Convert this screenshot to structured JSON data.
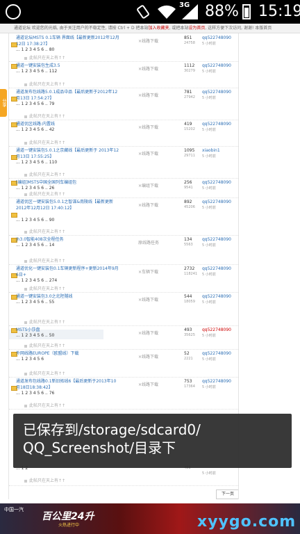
{
  "status_bar": {
    "network": "3G",
    "battery_percent": "88%",
    "time": "15:19"
  },
  "notice": {
    "text_a": "通道论坛 欢迎您的光临, 由于关注用户的不稳定性, 请按 Ctrl + D 把本站",
    "text_red": "加入收藏夹",
    "text_b": ", 或把本站",
    "text_red2": "设为首页",
    "text_c": ", 这样方便下次访问, 谢谢! 本版首页"
  },
  "left_tab": "分享",
  "threads": [
    {
      "title": "通道论坛MSTS 0.1车辆 界面线【最新更新2012年12月12日 17:38:27】",
      "pages": "... 1 2 3 4 5 6 .. 80",
      "category": "×线路下载",
      "replies": "851",
      "views": "24758",
      "last_user": "qq522748090",
      "last_time": "5 小时前",
      "note": "此帖只在天上有↑↑"
    },
    {
      "title": "通道一键安装包生成3.5",
      "pages": "... 1 2 3 4 5 6 .. 112",
      "category": "×线路下载",
      "replies": "1112",
      "views": "30279",
      "last_user": "qq522748090",
      "last_time": "5 小时前",
      "note": "此帖只在天上有↑↑"
    },
    {
      "title": "通道发布包线路5.0.1成品中品【最后更新于2012年12月13日 17:54:27】",
      "pages": "... 1 2 3 4 5 6 .. 79",
      "category": "×线路下载",
      "replies": "781",
      "views": "27942",
      "last_user": "qq522748090",
      "last_time": "5 小时前",
      "note": "此帖只在天上有↑↑"
    },
    {
      "title": "通道优区线路:内置线",
      "pages": "... 1 2 3 4 5 6 .. 42",
      "category": "×线路下载",
      "replies": "419",
      "views": "15202",
      "last_user": "qq522748090",
      "last_time": "5 小时前",
      "note": "此帖只在天上有↑↑"
    },
    {
      "title": "通道一键安装包5.0.1之京藏线【最后更新于 2013年12月13日 17:55:25】",
      "pages": "... 1 2 3 4 5 6 .. 110",
      "category": "×线路下载",
      "replies": "1095",
      "views": "29711",
      "last_user": "xiaobin1",
      "last_time": "5 小时前",
      "note": "此帖只在天上有↑↑"
    },
    {
      "title": "[编组]MSTS中国全国列车编组包",
      "pages": "... 1 2 3 4 5 6 .. 26",
      "category": "×编组下载",
      "replies": "256",
      "views": "9541",
      "last_user": "qq522748090",
      "last_time": "5 小时前",
      "note": "此帖只在天上有↑↑"
    },
    {
      "title": "通道优区一键安装包5.0.1之智谋&南陵线【最新更新2012年12月12日 17:40:12】",
      "pages": "... 1 2 3 4 5 6 .. 90",
      "category": "×线路下载",
      "replies": "892",
      "views": "45206",
      "last_user": "qq522748090",
      "last_time": "5 小时前",
      "note": "此帖只在天上有↑↑"
    },
    {
      "title": "jh3.0智能408次全程任务",
      "pages": "... 1 2 3 4 5 6 .. 14",
      "category": "原线路任务",
      "replies": "134",
      "views": "5563",
      "last_user": "qq522748090",
      "last_time": "5 小时前",
      "note": "此帖只在天上有↑↑"
    },
    {
      "title": "通道优化一键安装包0.1车辆更新程序+更新2014年9月6日+",
      "pages": "... 1 2 3 4 5 6 .. 274",
      "category": "×车辆下载",
      "replies": "2732",
      "views": "118241",
      "last_user": "qq522748090",
      "last_time": "5 小时前",
      "note": "此帖只在天上有↑↑"
    },
    {
      "title": "通道一键安装包3.0之北陉隧线",
      "pages": "... 1 2 3 4 5 6 .. 55",
      "category": "×线路下载",
      "replies": "544",
      "views": "18059",
      "last_user": "qq522748090",
      "last_time": "5 小时前",
      "note": "此帖只在天上有↑↑"
    },
    {
      "title": "MSTS小莎盘",
      "pages": "... 1 2 3 4 5 6 .. 50",
      "category": "×线路下载",
      "replies": "493",
      "views": "35625",
      "last_user": "qq522748090",
      "last_time": "5 小时前",
      "note": "此帖只在天上有↑↑"
    },
    {
      "title": "外网线路EUROPE（欧盟线）下载",
      "pages": "... 1 2 3 4 5 6",
      "category": "×线路下载",
      "replies": "52",
      "views": "2221",
      "last_user": "qq522748090",
      "last_time": "5 小时前",
      "note": "此帖只在天上有↑↑"
    },
    {
      "title": "通道发布包线路0.1新旧拓线6【最后更新于2013年10月18日18:38:42】",
      "pages": "... 1 2 3 4 5 6 .. 76",
      "category": "×线路下载",
      "replies": "753",
      "views": "17364",
      "last_user": "qq522748090",
      "last_time": "5 小时前",
      "note": "此帖只在天上有↑↑"
    }
  ],
  "partial_row": {
    "pages": "... 1 2",
    "views": "431",
    "last_time": "5 小时前",
    "note": "此帖只在天上有↑↑"
  },
  "next_page": "下一页",
  "toast": {
    "line1": "已保存到/storage/sdcard0/",
    "line2": "QQ_Screenshot/目录下"
  },
  "ad": {
    "brand": "中国一汽",
    "slogan": "百公里24升",
    "sub": "火热进行中",
    "site": "xyygo.com"
  }
}
